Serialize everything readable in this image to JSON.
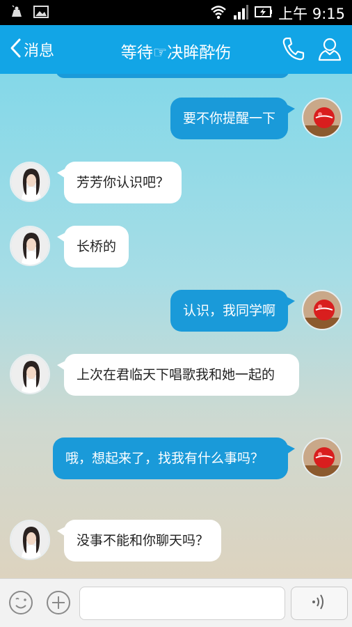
{
  "status_bar": {
    "time": "上午 9:15",
    "icons": [
      "android-notification-icon",
      "image-notification-icon",
      "wifi-icon",
      "signal-icon",
      "battery-charging-icon"
    ]
  },
  "header": {
    "back_label": "消息",
    "title": "等待☞决眸酔伤",
    "icons": [
      "phone-icon",
      "profile-icon"
    ]
  },
  "messages": [
    {
      "side": "out",
      "text": "要不你提醒一下"
    },
    {
      "side": "in",
      "text": "芳芳你认识吧？"
    },
    {
      "side": "in",
      "text": "长桥的"
    },
    {
      "side": "out",
      "text": "认识，我同学啊"
    },
    {
      "side": "in",
      "text": "上次在君临天下唱歌我和她一起的"
    },
    {
      "side": "out",
      "text": "哦，想起来了，找我有什么事吗？"
    },
    {
      "side": "in",
      "text": "没事不能和你聊天吗？"
    }
  ],
  "input_bar": {
    "icons": [
      "emoji-icon",
      "add-icon",
      "voice-icon"
    ],
    "placeholder": ""
  },
  "colors": {
    "accent": "#12a5e6",
    "outgoing_bubble": "#1a9ad9",
    "incoming_bubble": "#ffffff"
  }
}
